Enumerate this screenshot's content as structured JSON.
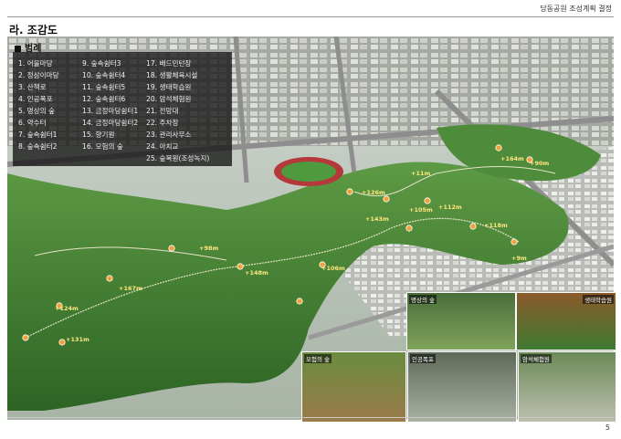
{
  "header": {
    "document_title": "당동공원 조성계획 결정",
    "section_title": "라. 조감도"
  },
  "legend": {
    "title": "범례",
    "col1": [
      "1. 어울마당",
      "2. 정삼이마당",
      "3. 산책로",
      "4. 인공폭포",
      "5. 명상의 숲",
      "6. 약수터",
      "7. 숲속쉼터1",
      "8. 숲속쉼터2"
    ],
    "col2": [
      "9. 숲속쉼터3",
      "10. 숲속쉼터4",
      "11. 숲속쉼터5",
      "12. 숲속쉼터6",
      "13. 금정마당쉼터1",
      "14. 금정마당쉼터2",
      "15. 향기원",
      "16. 모험의 숲"
    ],
    "col3": [
      "17. 배드민턴장",
      "18. 생활체육시설",
      "19. 생태학습원",
      "20. 암석체험원",
      "21. 전망대",
      "22. 주차장",
      "23. 관리사무소",
      "24. 아치교",
      "25. 숲복원(조성녹지)"
    ]
  },
  "distance_labels": [
    "+11m",
    "+126m",
    "+164m",
    "+90m",
    "+112m",
    "+105m",
    "+143m",
    "+118m",
    "+98m",
    "+148m",
    "+167m",
    "+124m",
    "+131m",
    "+9m",
    "+106m"
  ],
  "photos": {
    "meditation_forest": "명상의 숲",
    "eco_learning": "생태학습원",
    "adventure_forest": "모험의 숲",
    "artificial_waterfall": "인공폭포",
    "rock_experience": "암석체험원"
  },
  "page_number": "5",
  "colors": {
    "forest": "#3f7a32",
    "road": "#8e8e8e",
    "track": "#b5393a",
    "legend_bg": "#141414",
    "marker": "#f0a23a"
  }
}
